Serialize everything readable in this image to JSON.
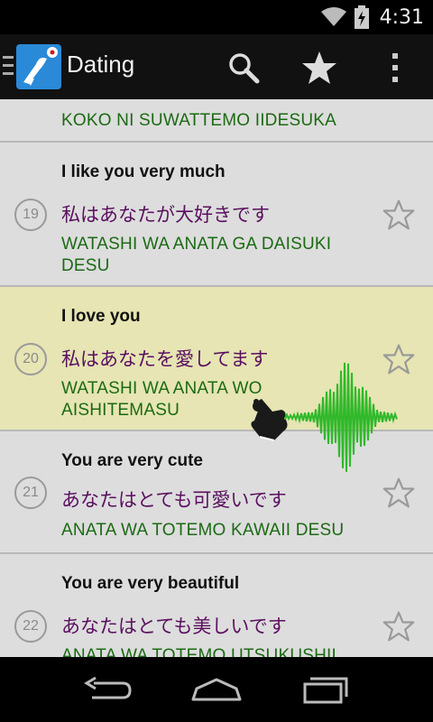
{
  "status_bar": {
    "time": "4:31"
  },
  "action_bar": {
    "title": "Dating"
  },
  "phrases": [
    {
      "english": "",
      "japanese": "",
      "romaji": "KOKO NI SUWATTEMO IIDESUKA"
    },
    {
      "number": "19",
      "english": "I like you very much",
      "japanese": "私はあなたが大好きです",
      "romaji": "WATASHI WA ANATA GA DAISUKI DESU"
    },
    {
      "number": "20",
      "english": "I love you",
      "japanese": "私はあなたを愛してます",
      "romaji": "WATASHI WA ANATA WO AISHITEMASU"
    },
    {
      "number": "21",
      "english": "You are very cute",
      "japanese": "あなたはとても可愛いです",
      "romaji": "ANATA WA TOTEMO KAWAII DESU"
    },
    {
      "number": "22",
      "english": "You are very beautiful",
      "japanese": "あなたはとても美しいです",
      "romaji": "ANATA WA TOTEMO UTSUKUSHII"
    }
  ],
  "colors": {
    "highlight_row": "#e6e5b3",
    "japanese_text": "#5b1060",
    "romaji_text": "#1b6a13",
    "waveform": "#2fb82a"
  }
}
